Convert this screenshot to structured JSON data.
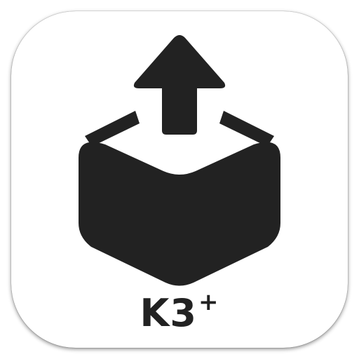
{
  "icon": {
    "name": "upload-box-icon",
    "background_color": "#ffffff",
    "glyph_color": "#222222"
  },
  "label": {
    "text": "K3",
    "superscript": "+"
  }
}
